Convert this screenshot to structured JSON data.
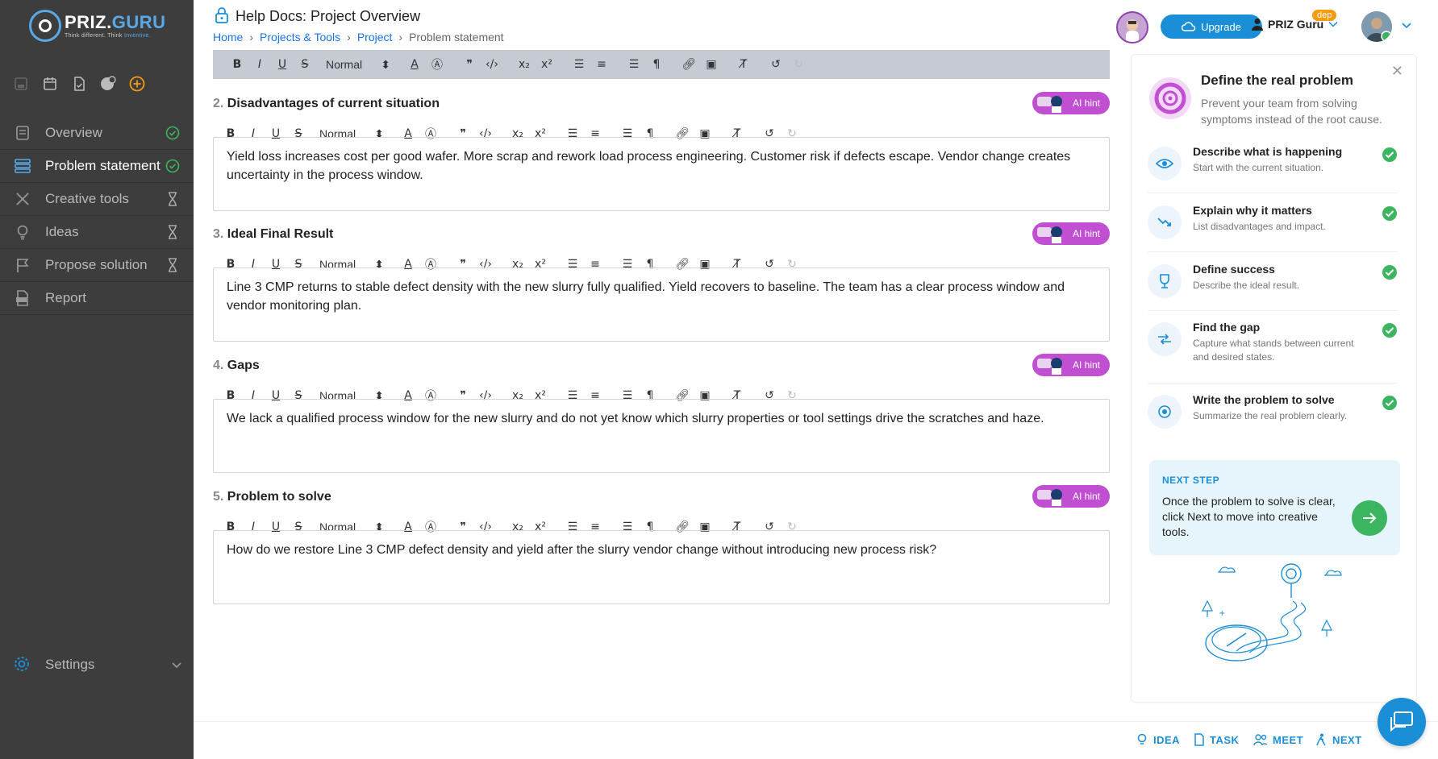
{
  "brand": {
    "name_part1": "PRIZ.",
    "name_part2": "GURU",
    "tagline_part1": "Think different. Think ",
    "tagline_part2": "Inventive."
  },
  "header": {
    "title": "Help Docs: Project Overview",
    "breadcrumb": [
      "Home",
      "Projects & Tools",
      "Project",
      "Problem statement"
    ],
    "upgrade_label": "Upgrade",
    "user_label": "PRIZ Guru",
    "dep_badge": "dep"
  },
  "sidebar": {
    "items": [
      {
        "label": "Overview",
        "status": "done"
      },
      {
        "label": "Problem statement",
        "status": "done",
        "active": true
      },
      {
        "label": "Creative tools",
        "status": "pending"
      },
      {
        "label": "Ideas",
        "status": "pending"
      },
      {
        "label": "Propose solution",
        "status": "pending"
      },
      {
        "label": "Report",
        "status": "none"
      }
    ],
    "settings_label": "Settings"
  },
  "toolbar": {
    "format": "Normal"
  },
  "sections": [
    {
      "num": "2.",
      "title": "Disadvantages of current situation",
      "hint": "AI hint",
      "text": "Yield loss increases cost per good wafer. More scrap and rework load process engineering. Customer risk if defects escape. Vendor change creates uncertainty in the process window."
    },
    {
      "num": "3.",
      "title": "Ideal Final Result",
      "hint": "AI hint",
      "text": "Line 3 CMP returns to stable defect density with the new slurry fully qualified. Yield recovers to baseline. The team has a clear process window and vendor monitoring plan."
    },
    {
      "num": "4.",
      "title": "Gaps",
      "hint": "AI hint",
      "text": "We lack a qualified process window for the new slurry and do not yet know which slurry properties or tool settings drive the scratches and haze."
    },
    {
      "num": "5.",
      "title": "Problem to solve",
      "hint": "AI hint",
      "text": "How do we restore Line 3 CMP defect density and yield after the slurry vendor change without introducing new process risk?"
    }
  ],
  "guide": {
    "title": "Define the real problem",
    "subtitle": "Prevent your team from solving symptoms instead of the root cause.",
    "steps": [
      {
        "title": "Describe what is happening",
        "desc": "Start with the current situation.",
        "icon": "eye-icon"
      },
      {
        "title": "Explain why it matters",
        "desc": "List disadvantages and impact.",
        "icon": "trend-down-icon"
      },
      {
        "title": "Define success",
        "desc": "Describe the ideal result.",
        "icon": "trophy-icon"
      },
      {
        "title": "Find the gap",
        "desc": "Capture what stands between current and desired states.",
        "icon": "arrows-icon"
      },
      {
        "title": "Write the problem to solve",
        "desc": "Summarize the real problem clearly.",
        "icon": "target-icon"
      }
    ],
    "next_label": "NEXT STEP",
    "next_text": "Once the problem to solve is clear, click Next to move into creative tools."
  },
  "bottom": {
    "idea": "IDEA",
    "task": "TASK",
    "meet": "MEET",
    "next": "NEXT"
  },
  "colors": {
    "accent": "#1a8fd8",
    "ai_hint": "#c04fd1",
    "success": "#3bb55f",
    "sidebar": "#3d3d3d"
  }
}
